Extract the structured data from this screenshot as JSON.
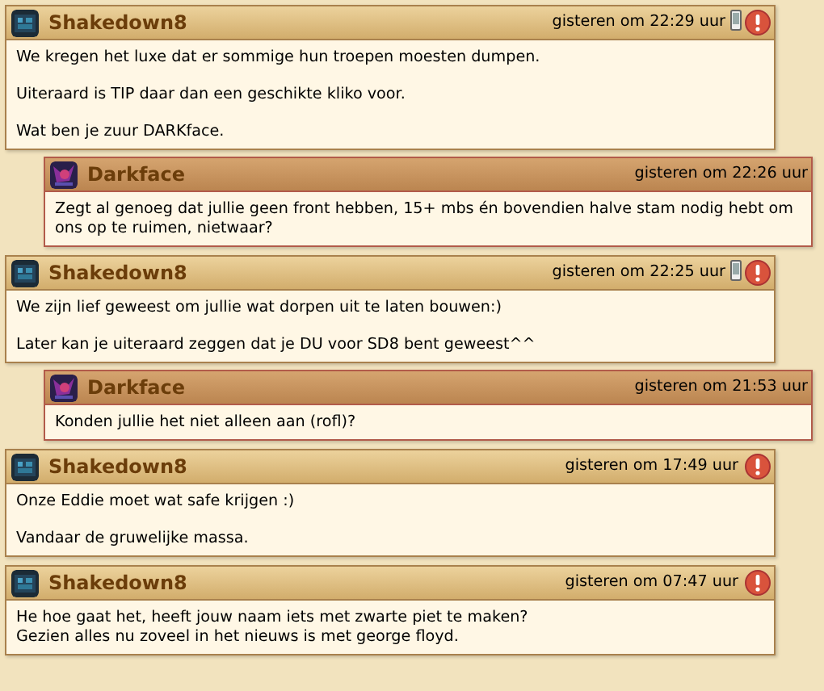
{
  "posts": [
    {
      "kind": "own",
      "author": "Shakedown8",
      "time": "gisteren om 22:29 uur",
      "mobile": true,
      "report": true,
      "paragraphs": [
        [
          "We kregen het luxe dat er sommige hun troepen moesten dumpen."
        ],
        [
          "Uiteraard is TIP daar dan een geschikte kliko voor."
        ],
        [
          "Wat ben je zuur DARKface."
        ]
      ]
    },
    {
      "kind": "reply",
      "author": "Darkface",
      "time": "gisteren om 22:26 uur",
      "mobile": false,
      "report": false,
      "paragraphs": [
        [
          "Zegt al genoeg dat jullie geen front hebben, 15+ mbs én bovendien halve stam nodig hebt om ons op te ruimen, nietwaar?"
        ]
      ]
    },
    {
      "kind": "own",
      "author": "Shakedown8",
      "time": "gisteren om 22:25 uur",
      "mobile": true,
      "report": true,
      "paragraphs": [
        [
          "We zijn lief geweest om jullie wat dorpen uit te laten bouwen:)"
        ],
        [
          "Later kan je uiteraard zeggen dat je DU voor SD8 bent geweest^^"
        ]
      ]
    },
    {
      "kind": "reply",
      "author": "Darkface",
      "time": "gisteren om 21:53 uur",
      "mobile": false,
      "report": false,
      "paragraphs": [
        [
          "Konden jullie het niet alleen aan (rofl)?"
        ]
      ]
    },
    {
      "kind": "own",
      "author": "Shakedown8",
      "time": "gisteren om 17:49 uur",
      "mobile": false,
      "report": true,
      "paragraphs": [
        [
          "Onze Eddie moet wat safe krijgen :)"
        ],
        [
          "Vandaar de gruwelijke massa."
        ]
      ]
    },
    {
      "kind": "own",
      "author": "Shakedown8",
      "time": "gisteren om 07:47 uur",
      "mobile": false,
      "report": true,
      "paragraphs": [
        [
          "He hoe gaat het, heeft jouw naam iets met zwarte piet te maken?",
          "Gezien alles nu zoveel in het nieuws is met george floyd."
        ]
      ]
    }
  ]
}
